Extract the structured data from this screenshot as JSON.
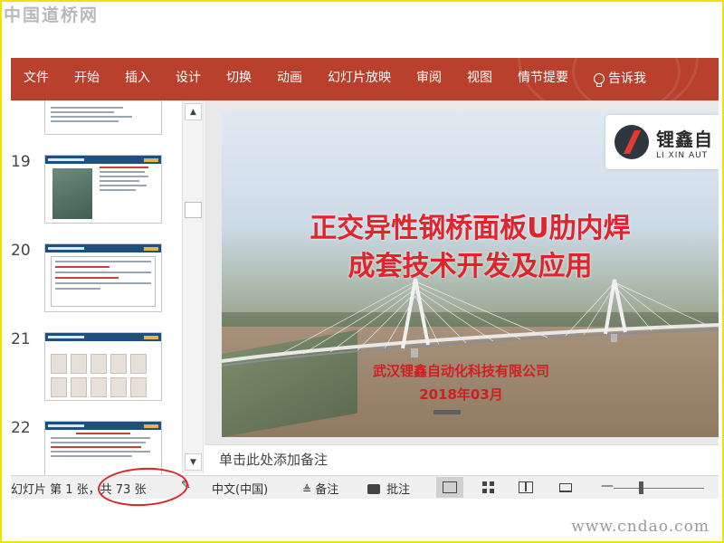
{
  "watermark": {
    "top": "中国道桥网",
    "bottom": "www.cndao.com"
  },
  "ribbon": {
    "tabs": [
      "文件",
      "开始",
      "插入",
      "设计",
      "切换",
      "动画",
      "幻灯片放映",
      "审阅",
      "视图",
      "情节提要"
    ],
    "tell_me": "告诉我"
  },
  "thumbnails": {
    "numbers": [
      "19",
      "20",
      "21",
      "22"
    ]
  },
  "slide": {
    "title_line1": "正交异性钢桥面板U肋内焊",
    "title_line2": "成套技术开发及应用",
    "company": "武汉锂鑫自动化科技有限公司",
    "date": "2018年03月",
    "logo_cn": "锂鑫自",
    "logo_en": "LI XIN AUT"
  },
  "notes": {
    "placeholder": "单击此处添加备注"
  },
  "statusbar": {
    "slide_info": "幻灯片 第 1 张，共 73 张",
    "language": "中文(中国)",
    "notes_label": "备注",
    "comments_label": "批注"
  },
  "colors": {
    "ribbon": "#b8402c",
    "frame": "#f2e200",
    "highlight_circle": "#d9262a",
    "slide_title": "#e0242c"
  }
}
